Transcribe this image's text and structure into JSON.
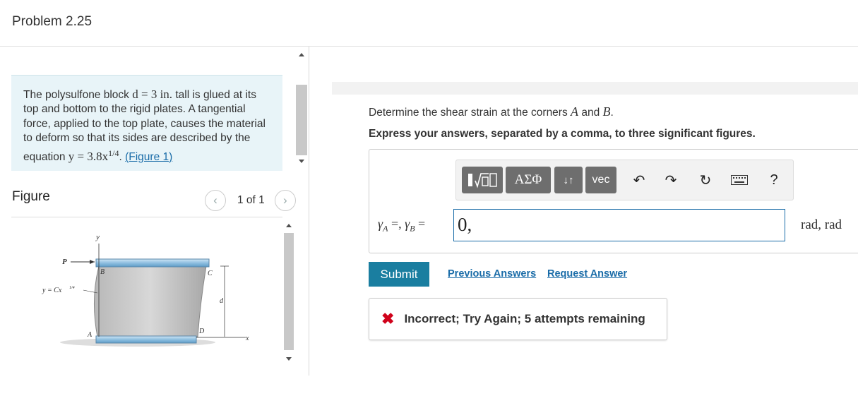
{
  "header": {
    "title": "Problem 2.25"
  },
  "problem": {
    "text_1": "The polysulfone block ",
    "math_d": "d = 3 in.",
    "text_2": " tall is glued at its top and bottom to the rigid plates. A tangential force, applied to the top plate, causes the material to deform so that its sides are described by the equation ",
    "math_eq": "y = 3.8x",
    "math_exp": "1/4",
    "text_3": ". ",
    "figure_link": "(Figure 1)"
  },
  "figure": {
    "label": "Figure",
    "pager_text": "1 of 1",
    "prev_icon": "chevron-left-icon",
    "next_icon": "chevron-right-icon",
    "labels": {
      "y": "y",
      "p": "P",
      "eq": "y = Cx",
      "eq_exp": "1/4",
      "b": "B",
      "c": "C",
      "d": "d",
      "dd": "D",
      "a": "A",
      "x": "x"
    }
  },
  "question": {
    "prefix": "Determine the shear strain at the corners ",
    "a": "A",
    "mid": " and ",
    "b": "B",
    "suffix": ".",
    "instruction": "Express your answers, separated by a comma, to three significant figures."
  },
  "toolbar": {
    "templates_icon": "templates-icon",
    "greek": "ΑΣΦ",
    "arrows": "↓↑",
    "vec": "vec",
    "undo_icon": "undo-icon",
    "redo_icon": "redo-icon",
    "reset_icon": "reset-icon",
    "keyboard_icon": "keyboard-icon",
    "help": "?"
  },
  "answer": {
    "label_a": "γ",
    "sub_a": "A",
    "label_sep": " =, ",
    "label_b": "γ",
    "sub_b": "B",
    "label_eq": " =",
    "value": "0,",
    "units": "rad, rad"
  },
  "actions": {
    "submit": "Submit",
    "previous": "Previous Answers",
    "request": "Request Answer"
  },
  "feedback": {
    "icon": "✖",
    "message": "Incorrect; Try Again; 5 attempts remaining"
  },
  "colors": {
    "accent": "#1a7ea0",
    "link": "#1a6ca8",
    "error": "#d0021b",
    "problem_bg": "#e8f4f8"
  }
}
